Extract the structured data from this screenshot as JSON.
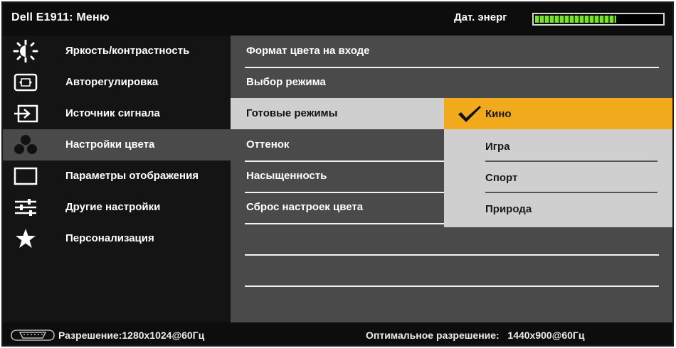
{
  "header": {
    "title": "Dell E1911: Меню",
    "energy_label": "Дат. энерг",
    "energy_level": 0.64
  },
  "sidebar": {
    "items": [
      {
        "label": "Яркость/контрастность",
        "icon": "brightness-icon"
      },
      {
        "label": "Авторегулировка",
        "icon": "auto-adjust-icon"
      },
      {
        "label": "Источник сигнала",
        "icon": "input-source-icon"
      },
      {
        "label": "Настройки цвета",
        "icon": "color-settings-icon",
        "active": true
      },
      {
        "label": "Параметры отображения",
        "icon": "display-settings-icon"
      },
      {
        "label": "Другие настройки",
        "icon": "other-settings-icon"
      },
      {
        "label": "Персонализация",
        "icon": "star-icon"
      }
    ]
  },
  "submenu": {
    "items": [
      {
        "label": "Формат цвета на входе"
      },
      {
        "label": "Выбор режима"
      },
      {
        "label": "Готовые режимы",
        "active": true
      },
      {
        "label": "Оттенок"
      },
      {
        "label": "Насыщенность"
      },
      {
        "label": "Сброс настроек цвета"
      }
    ]
  },
  "options": {
    "items": [
      {
        "label": "Кино",
        "selected": true
      },
      {
        "label": "Игра"
      },
      {
        "label": "Спорт"
      },
      {
        "label": "Природа"
      }
    ]
  },
  "status": {
    "resolution": "Разрешение:1280x1024@60Гц",
    "optimal_label": "Оптимальное разрешение:",
    "optimal_value": "1440x900@60Гц"
  },
  "colors": {
    "selected_option": "#f0aa1c",
    "energy_bar": "#7ee02b",
    "panel_bg": "#4a4a4a"
  }
}
